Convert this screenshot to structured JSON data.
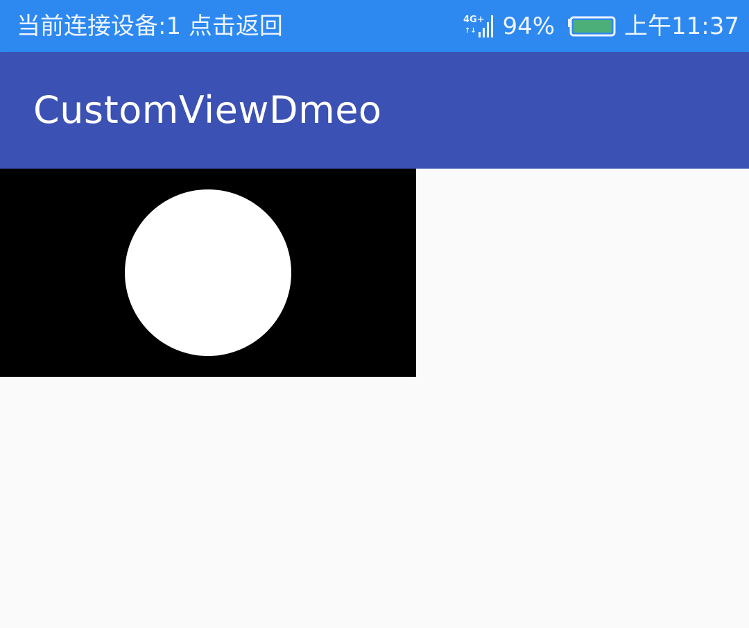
{
  "status_bar": {
    "left_text": "当前连接设备:1  点击返回",
    "network_label": "4G+",
    "battery_percent": "94%",
    "time": "上午11:37",
    "background_color": "#2d89f0",
    "battery_fill_color": "#4caf7a",
    "icons": [
      "signal-4g-icon",
      "battery-icon"
    ]
  },
  "app_bar": {
    "title": "CustomViewDmeo",
    "background_color": "#3b51b3"
  },
  "content": {
    "custom_view": {
      "background_color": "#000000",
      "circle_color": "#ffffff"
    }
  }
}
